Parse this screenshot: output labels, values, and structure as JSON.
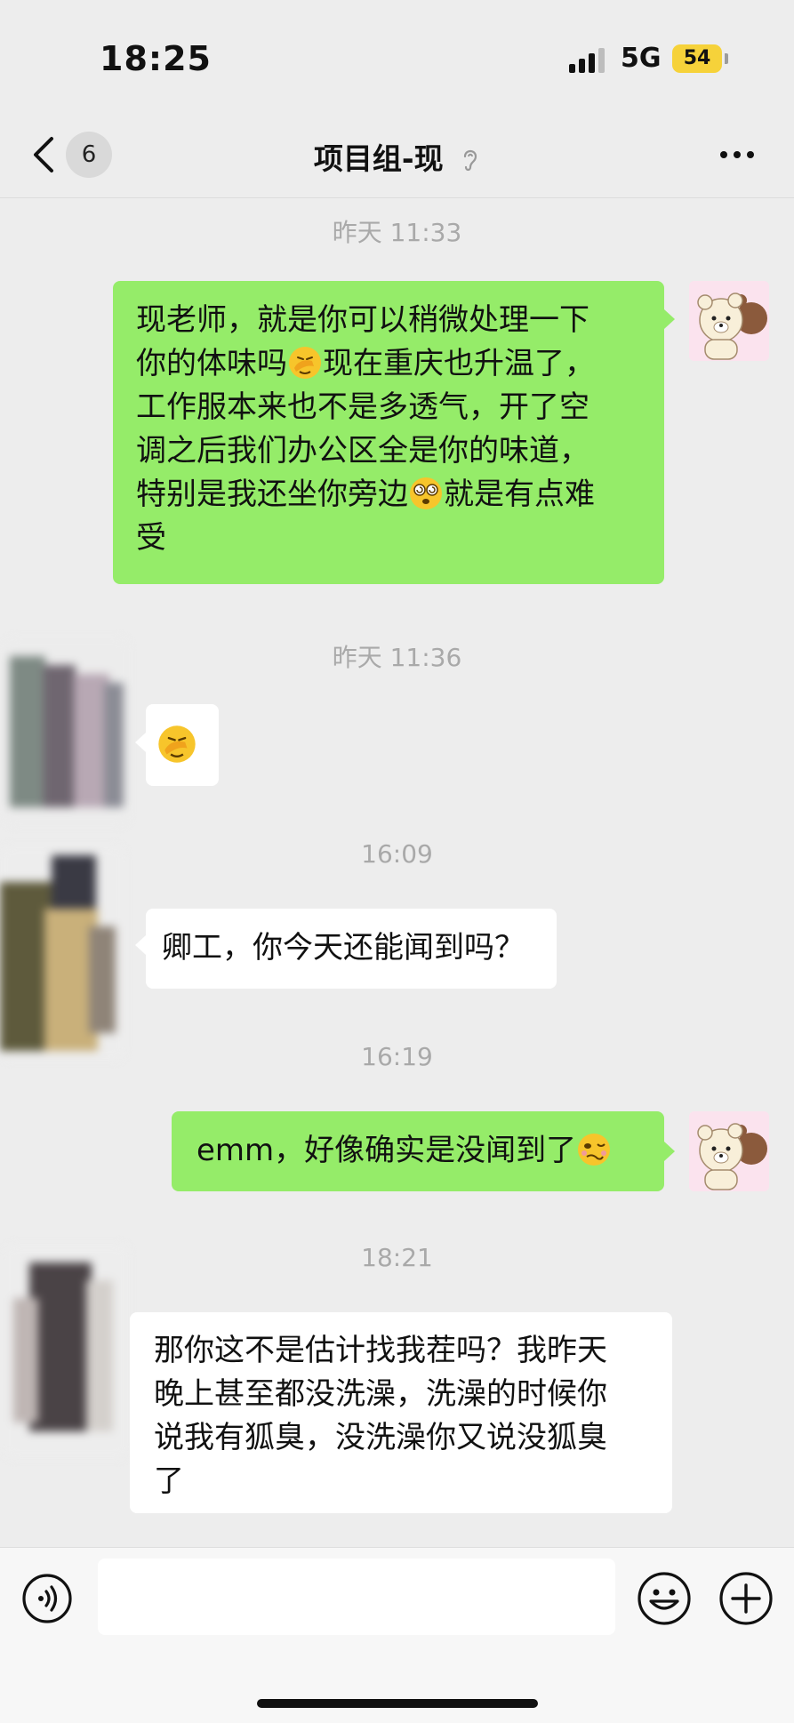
{
  "status_bar": {
    "time": "18:25",
    "network": "5G",
    "battery": "54"
  },
  "nav": {
    "unread_count": "6",
    "title": "项目组-现",
    "back_icon": "chevron-left-icon",
    "muted_icon": "ear-icon",
    "more_icon": "more-dots-icon"
  },
  "messages": [
    {
      "timestamp": "昨天 11:33"
    },
    {
      "side": "out",
      "lines": [
        "现老师，就是你可以稍微处理一下",
        "你的体味吗",
        "现在重庆也升温了，",
        "工作服本来也不是多透气，开了空",
        "调之后我们办公区全是你的味道，",
        "特别是我还坐你旁边",
        "就是有点难",
        "受"
      ],
      "emojis": [
        "facepalm-emoji",
        "dizzy-face-emoji"
      ]
    },
    {
      "timestamp": "昨天 11:36"
    },
    {
      "side": "in",
      "emojis": [
        "facepalm-emoji"
      ]
    },
    {
      "timestamp": "16:09"
    },
    {
      "side": "in",
      "text": "卿工，你今天还能闻到吗？"
    },
    {
      "timestamp": "16:19"
    },
    {
      "side": "out",
      "text": "emm，好像确实是没闻到了",
      "emojis": [
        "woozy-face-emoji"
      ]
    },
    {
      "timestamp": "18:21"
    },
    {
      "side": "in",
      "lines": [
        "那你这不是估计找我茬吗？我昨天",
        "晚上甚至都没洗澡，洗澡的时候你",
        "说我有狐臭，没洗澡你又说没狐臭",
        "了"
      ]
    }
  ],
  "input_bar": {
    "voice_icon": "voice-icon",
    "emoji_icon": "smile-icon",
    "plus_icon": "plus-circle-icon"
  },
  "colors": {
    "background": "#ededed",
    "outgoing_bubble": "#95ec69",
    "incoming_bubble": "#ffffff",
    "timestamp": "#a9a9a9",
    "battery": "#f6d23a"
  }
}
